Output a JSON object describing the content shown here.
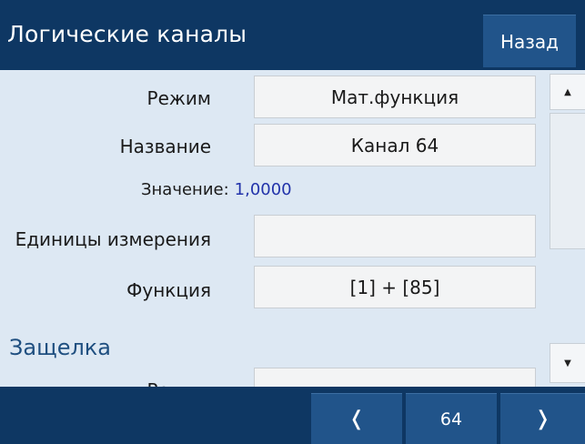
{
  "header": {
    "title": "Логические каналы",
    "back_label": "Назад"
  },
  "form": {
    "mode_label": "Режим",
    "mode_value": "Мат.функция",
    "name_label": "Название",
    "name_value": "Канал 64",
    "value_label": "Значение:",
    "value_value": "1,0000",
    "units_label": "Единицы измерения",
    "units_value": "",
    "function_label": "Функция",
    "function_value": "[1] + [85]",
    "latch_section": "Защелка",
    "latch_mode_label": "Режим"
  },
  "footer": {
    "prev_icon": "chevron-left-icon",
    "page": "64",
    "next_icon": "chevron-right-icon"
  },
  "colors": {
    "bar": "#0e3763",
    "button": "#21548a",
    "panel": "#dde8f3",
    "value": "#2233aa",
    "section": "#1f4f80"
  }
}
